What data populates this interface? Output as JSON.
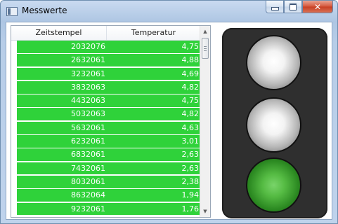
{
  "window": {
    "title": "Messwerte",
    "buttons": {
      "minimize": "",
      "maximize": "",
      "close": "✕"
    }
  },
  "grid": {
    "columns": [
      "Zeitstempel",
      "Temperatur"
    ],
    "rows": [
      [
        "2032076",
        "4,75"
      ],
      [
        "2632061",
        "4,88"
      ],
      [
        "3232061",
        "4,69"
      ],
      [
        "3832063",
        "4,82"
      ],
      [
        "4432063",
        "4,75"
      ],
      [
        "5032063",
        "4,82"
      ],
      [
        "5632061",
        "4,63"
      ],
      [
        "6232061",
        "3,01"
      ],
      [
        "6832061",
        "2,63"
      ],
      [
        "7432061",
        "2,63"
      ],
      [
        "8032061",
        "2,38"
      ],
      [
        "8632064",
        "1,94"
      ],
      [
        "9232061",
        "1,76"
      ]
    ],
    "row_color": "#2fd23a",
    "scrollbar": {
      "up_arrow": "▲",
      "down_arrow": "▼"
    }
  },
  "traffic_light": {
    "lamps": [
      {
        "name": "top-lamp",
        "state": "off"
      },
      {
        "name": "middle-lamp",
        "state": "off"
      },
      {
        "name": "bottom-lamp",
        "state": "green"
      }
    ],
    "active_color": "#3fa62f"
  }
}
